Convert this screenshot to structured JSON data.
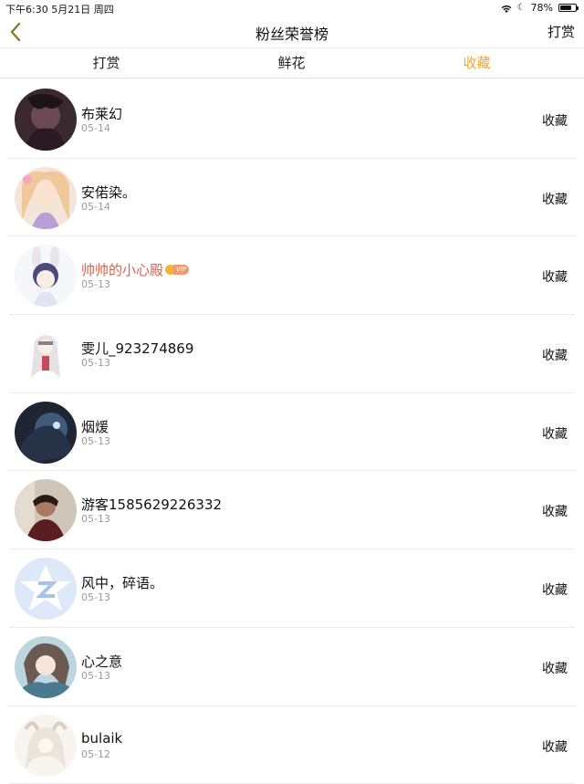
{
  "status_bar": {
    "time": "下午6:30   5月21日 周四",
    "battery": "78%",
    "battery_level": 0.78,
    "icons": [
      "wifi-icon",
      "moon-icon",
      "battery-icon"
    ]
  },
  "nav": {
    "back_icon": "chevron-left-icon",
    "title": "粉丝荣誉榜",
    "right_label": "打赏"
  },
  "tabs": [
    {
      "label": "打赏"
    },
    {
      "label": "鲜花"
    },
    {
      "label": "收藏",
      "active": true
    }
  ],
  "colors": {
    "accent": "#f0a62b",
    "vip_name": "#e35c46",
    "date": "#9a9a9a"
  },
  "rows": [
    {
      "name": "布莱幻",
      "date": "05-14",
      "action": "收藏"
    },
    {
      "name": "安偌染。",
      "date": "05-14",
      "action": "收藏"
    },
    {
      "name": "帅帅的小心殿",
      "date": "05-13",
      "action": "收藏",
      "vip": "VIP"
    },
    {
      "name": "雯儿_923274869",
      "date": "05-13",
      "action": "收藏"
    },
    {
      "name": "烟煖",
      "date": "05-13",
      "action": "收藏"
    },
    {
      "name": "游客1585629226332",
      "date": "05-13",
      "action": "收藏"
    },
    {
      "name": "风中，碎语。",
      "date": "05-13",
      "action": "收藏"
    },
    {
      "name": "心之意",
      "date": "05-13",
      "action": "收藏"
    },
    {
      "name": "bulaik",
      "date": "05-12",
      "action": "收藏"
    }
  ]
}
